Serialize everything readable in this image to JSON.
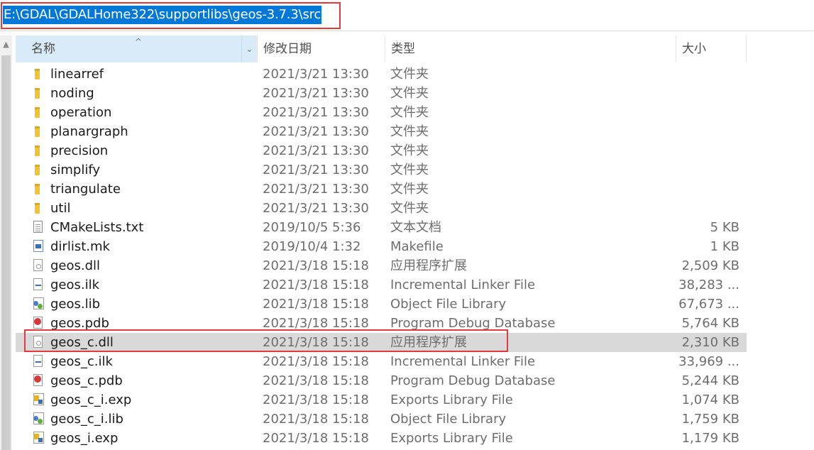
{
  "address_bar": {
    "path": "E:\\GDAL\\GDALHome322\\supportlibs\\geos-3.7.3\\src"
  },
  "columns": {
    "name": "名称",
    "date": "修改日期",
    "type": "类型",
    "size": "大小"
  },
  "icons": {
    "sort_indicator": "sort-up-icon",
    "dropdown": "chevron-down-icon",
    "scroll_up": "scroll-up-icon"
  },
  "files": [
    {
      "name": "linearref",
      "date": "2021/3/21 13:30",
      "type": "文件夹",
      "size": "",
      "icon": "folder"
    },
    {
      "name": "noding",
      "date": "2021/3/21 13:30",
      "type": "文件夹",
      "size": "",
      "icon": "folder"
    },
    {
      "name": "operation",
      "date": "2021/3/21 13:30",
      "type": "文件夹",
      "size": "",
      "icon": "folder"
    },
    {
      "name": "planargraph",
      "date": "2021/3/21 13:30",
      "type": "文件夹",
      "size": "",
      "icon": "folder"
    },
    {
      "name": "precision",
      "date": "2021/3/21 13:30",
      "type": "文件夹",
      "size": "",
      "icon": "folder"
    },
    {
      "name": "simplify",
      "date": "2021/3/21 13:30",
      "type": "文件夹",
      "size": "",
      "icon": "folder"
    },
    {
      "name": "triangulate",
      "date": "2021/3/21 13:30",
      "type": "文件夹",
      "size": "",
      "icon": "folder"
    },
    {
      "name": "util",
      "date": "2021/3/21 13:30",
      "type": "文件夹",
      "size": "",
      "icon": "folder"
    },
    {
      "name": "CMakeLists.txt",
      "date": "2019/10/5 5:36",
      "type": "文本文档",
      "size": "5 KB",
      "icon": "text-file"
    },
    {
      "name": "dirlist.mk",
      "date": "2019/10/4 1:32",
      "type": "Makefile",
      "size": "1 KB",
      "icon": "makefile"
    },
    {
      "name": "geos.dll",
      "date": "2021/3/18 15:18",
      "type": "应用程序扩展",
      "size": "2,509 KB",
      "icon": "dll-file"
    },
    {
      "name": "geos.ilk",
      "date": "2021/3/18 15:18",
      "type": "Incremental Linker File",
      "size": "38,283 ...",
      "icon": "ilk-file"
    },
    {
      "name": "geos.lib",
      "date": "2021/3/18 15:18",
      "type": "Object File Library",
      "size": "67,673 ...",
      "icon": "lib-file"
    },
    {
      "name": "geos.pdb",
      "date": "2021/3/18 15:18",
      "type": "Program Debug Database",
      "size": "5,764 KB",
      "icon": "pdb-file"
    },
    {
      "name": "geos_c.dll",
      "date": "2021/3/18 15:18",
      "type": "应用程序扩展",
      "size": "2,310 KB",
      "icon": "dll-file",
      "selected": true
    },
    {
      "name": "geos_c.ilk",
      "date": "2021/3/18 15:18",
      "type": "Incremental Linker File",
      "size": "33,969 ...",
      "icon": "ilk-file"
    },
    {
      "name": "geos_c.pdb",
      "date": "2021/3/18 15:18",
      "type": "Program Debug Database",
      "size": "5,244 KB",
      "icon": "pdb-file"
    },
    {
      "name": "geos_c_i.exp",
      "date": "2021/3/18 15:18",
      "type": "Exports Library File",
      "size": "1,074 KB",
      "icon": "exp-file"
    },
    {
      "name": "geos_c_i.lib",
      "date": "2021/3/18 15:18",
      "type": "Object File Library",
      "size": "1,759 KB",
      "icon": "lib-file"
    },
    {
      "name": "geos_i.exp",
      "date": "2021/3/18 15:18",
      "type": "Exports Library File",
      "size": "1,179 KB",
      "icon": "exp-file"
    }
  ],
  "colors": {
    "selection_highlight": "#0078d7",
    "annotation_red": "#e0393e",
    "row_selected": "#d9d9d9",
    "header_active": "#d9ebf9"
  }
}
